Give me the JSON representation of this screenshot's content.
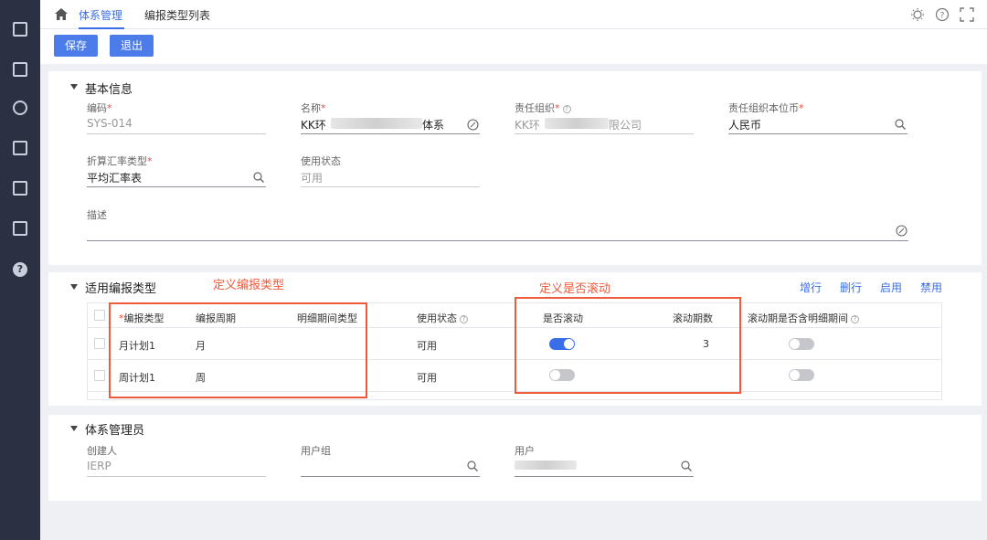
{
  "nav": {
    "icons": [
      "panel-icon",
      "report-icon",
      "circle-icon",
      "edit-icon",
      "clipboard-icon",
      "document-icon",
      "help-icon"
    ]
  },
  "topbar": {
    "tabs": [
      "体系管理",
      "编报类型列表"
    ],
    "right_icons": [
      "bulb-icon",
      "help-icon",
      "fullscreen-icon"
    ]
  },
  "toolbar": {
    "save_label": "保存",
    "exit_label": "退出"
  },
  "basic_info": {
    "title": "基本信息",
    "code_label": "编码",
    "code_value": "SYS-014",
    "name_label": "名称",
    "name_prefix": "KK环",
    "name_suffix": "体系",
    "org_label": "责任组织",
    "org_prefix": "KK环",
    "org_suffix": "限公司",
    "currency_label": "责任组织本位币",
    "currency_value": "人民币",
    "rate_label": "折算汇率类型",
    "rate_value": "平均汇率表",
    "status_label": "使用状态",
    "status_value": "可用",
    "desc_label": "描述"
  },
  "report_types": {
    "title": "适用编报类型",
    "actions": [
      "增行",
      "删行",
      "启用",
      "禁用"
    ],
    "columns": [
      "编报类型",
      "编报周期",
      "明细期间类型",
      "使用状态",
      "是否滚动",
      "滚动期数",
      "滚动期是否含明细期间"
    ],
    "rows": [
      {
        "type": "月计划1",
        "period": "月",
        "detail": "",
        "status": "可用",
        "rolling": true,
        "rolling_periods": "3",
        "rolling_detail": false
      },
      {
        "type": "周计划1",
        "period": "周",
        "detail": "",
        "status": "可用",
        "rolling": false,
        "rolling_periods": "",
        "rolling_detail": false
      }
    ],
    "annotation_left": "定义编报类型",
    "annotation_right": "定义是否滚动"
  },
  "admin": {
    "title": "体系管理员",
    "creator_label": "创建人",
    "creator_value": "IERP",
    "group_label": "用户组",
    "user_label": "用户"
  },
  "colors": {
    "accent": "#3a6ee8",
    "annotation": "#f05a3c",
    "nav_bg": "#2b3142"
  }
}
